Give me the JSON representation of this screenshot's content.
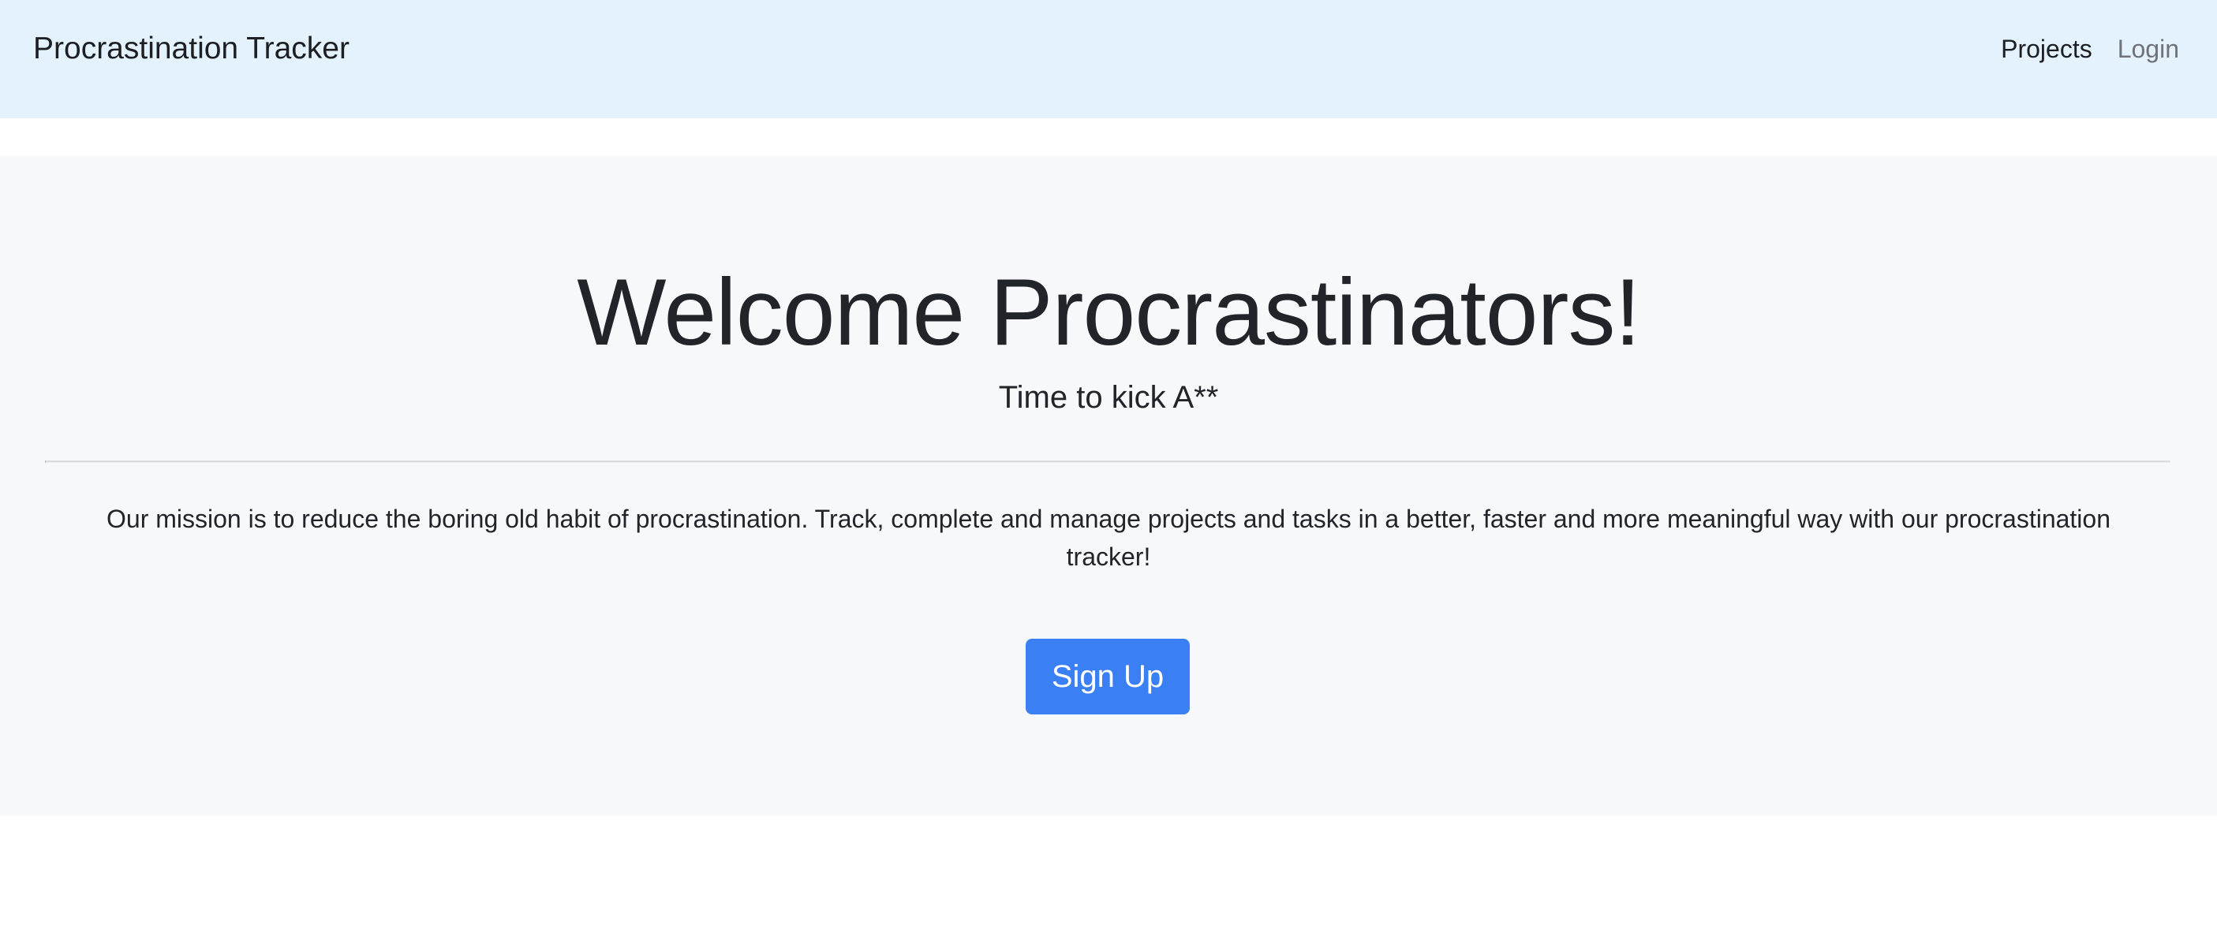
{
  "navbar": {
    "brand": "Procrastination Tracker",
    "links": [
      {
        "label": "Projects",
        "state": "active"
      },
      {
        "label": "Login",
        "state": "muted"
      }
    ],
    "background": "#e3f2fd"
  },
  "hero": {
    "title": "Welcome Procrastinators!",
    "subtitle": "Time to kick A**",
    "mission": "Our mission is to reduce the boring old habit of procrastination. Track, complete and manage projects and tasks in a better, faster and more meaningful way with our procrastination tracker!",
    "cta_label": "Sign Up",
    "cta_color": "#3b7ff5",
    "background": "#f7f8fa"
  }
}
